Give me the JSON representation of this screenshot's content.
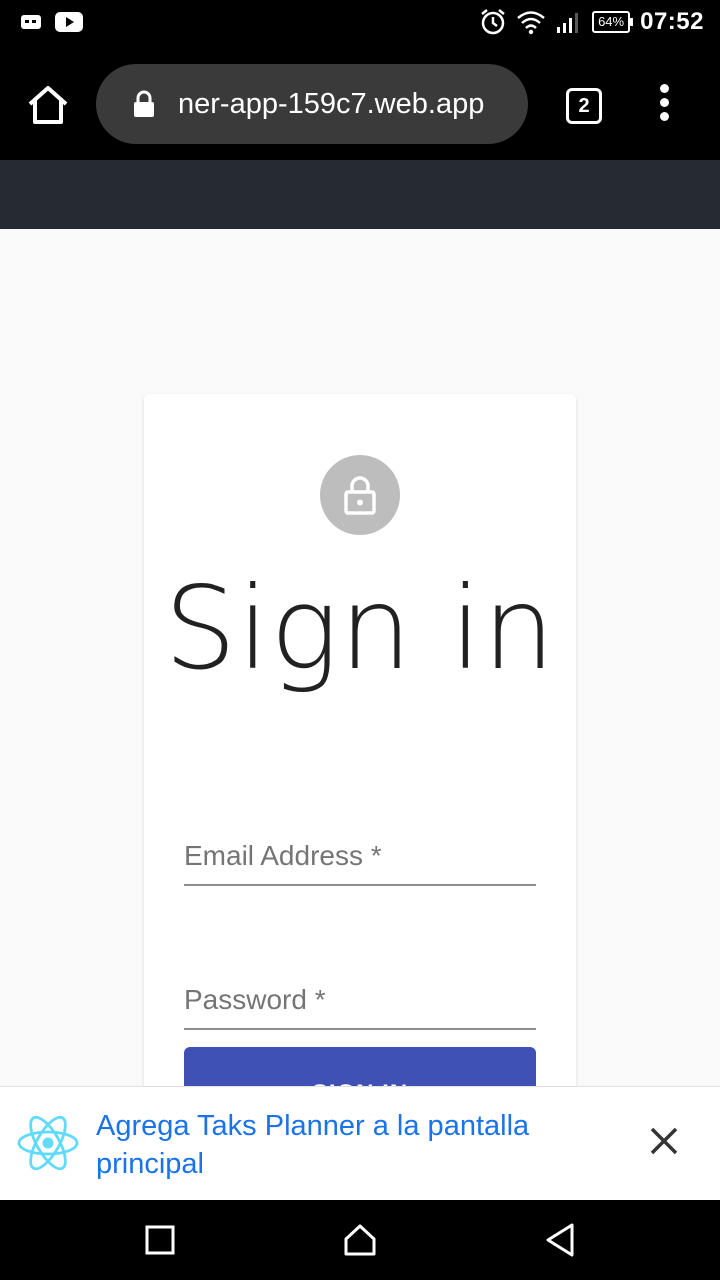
{
  "status_bar": {
    "battery": "64%",
    "time": "07:52",
    "icons": [
      "notification-icon",
      "youtube-icon",
      "alarm-icon",
      "wifi-icon",
      "signal-icon",
      "battery-icon"
    ]
  },
  "browser": {
    "url": "ner-app-159c7.web.app",
    "tab_count": "2",
    "icons": [
      "home-icon",
      "lock-icon",
      "more-vert-icon"
    ]
  },
  "login": {
    "title": "Sign in",
    "email_placeholder": "Email Address *",
    "password_placeholder": "Password *",
    "submit_label": "SIGN IN",
    "icon": "lock-icon"
  },
  "install_banner": {
    "text": "Agrega Taks Planner a la pantalla principal",
    "icons": [
      "react-logo-icon",
      "close-icon"
    ]
  },
  "nav_bar": {
    "icons": [
      "recents-icon",
      "home-icon",
      "back-icon"
    ]
  },
  "colors": {
    "status_bar_bg": "#000000",
    "app_header_bg": "#262a33",
    "page_bg": "#fafafa",
    "button_primary": "#3f51b5",
    "avatar_bg": "#bdbdbd",
    "banner_link": "#1a73e8",
    "react_logo": "#61dafb"
  }
}
